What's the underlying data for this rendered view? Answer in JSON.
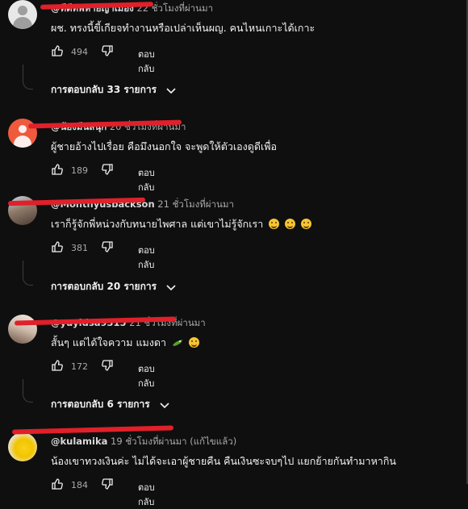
{
  "comments": [
    {
      "author": "@ทีดีทัพหายญาเมือง",
      "time": "22 ชั่วโมงที่ผ่านมา",
      "text": "ผช. ทรงนี้ขี้เกียจทำงานหรือเปล่าเห็นผญ. คนไหนเกาะได้เกาะ",
      "likes": "494",
      "reply_label": "ตอบกลับ",
      "replies_label": "การตอบกลับ 33 รายการ"
    },
    {
      "author": "@น้องมีนสนุก",
      "time": "20 ชั่วโมงที่ผ่านมา",
      "text": "ผู้ชายอ้างไปเรื่อย คือมึงนอกใจ จะพูดให้ตัวเองดูดีเพื่อ",
      "likes": "189",
      "reply_label": "ตอบกลับ"
    },
    {
      "author": "@Monthyusbackson",
      "time": "21 ชั่วโมงที่ผ่านมา",
      "text": "เราก็รู้จักพี่หน่วงกับทนายไพศาล แต่เขาไม่รู้จักเรา",
      "emojis": [
        "tears-of-joy",
        "tears-of-joy",
        "tears-of-joy"
      ],
      "likes": "381",
      "reply_label": "ตอบกลับ",
      "replies_label": "การตอบกลับ 20 รายการ"
    },
    {
      "author": "@yuyidsa9315",
      "time": "21 ชั่วโมงที่ผ่านมา",
      "text": "สั้นๆ แต่ได้ใจความ แมงดา",
      "emojis": [
        "crocodile",
        "smiling-face"
      ],
      "likes": "172",
      "reply_label": "ตอบกลับ",
      "replies_label": "การตอบกลับ 6 รายการ"
    },
    {
      "author": "@kulamika",
      "time": "19 ชั่วโมงที่ผ่านมา (แก้ไขแล้ว)",
      "text": "น้องเขาทวงเงินค่ะ  ไม่ได้จะเอาผู้ชายคืน   คืนเงินซะจบๆไป   แยกย้ายกันทำมาหากิน",
      "likes": "184",
      "reply_label": "ตอบกลับ"
    }
  ],
  "icons": {
    "like": "thumb-up-icon",
    "dislike": "thumb-down-icon",
    "expand": "chevron-down-icon"
  },
  "colors": {
    "background": "#0f0f0f",
    "redaction": "#e0202a",
    "text": "#f1f1f1",
    "muted": "#aaaaaa"
  }
}
